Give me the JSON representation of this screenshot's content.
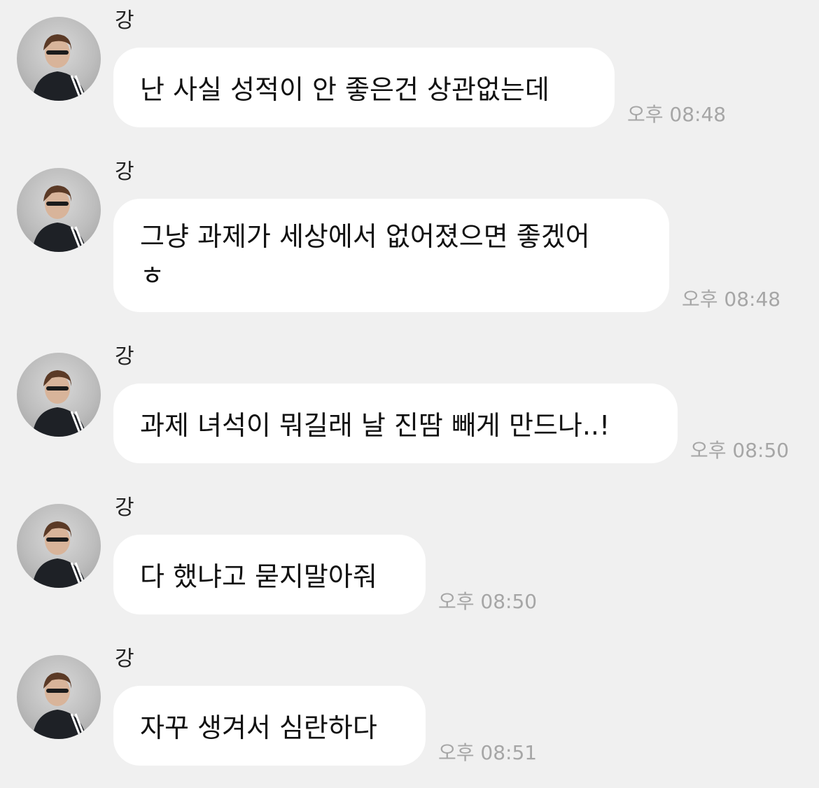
{
  "chat": {
    "messages": [
      {
        "sender": "강",
        "text": "난 사실 성적이 안 좋은건 상관없는데",
        "time": "오후 08:48"
      },
      {
        "sender": "강",
        "text": "그냥 과제가 세상에서 없어졌으면 좋겠어\nㅎ",
        "time": "오후 08:48"
      },
      {
        "sender": "강",
        "text": "과제 녀석이 뭐길래 날 진땀 빼게 만드나..!",
        "time": "오후 08:50"
      },
      {
        "sender": "강",
        "text": "다 했냐고 묻지말아줘",
        "time": "오후 08:50"
      },
      {
        "sender": "강",
        "text": "자꾸 생겨서 심란하다",
        "time": "오후 08:51"
      }
    ]
  },
  "colors": {
    "background": "#f0f0f0",
    "bubble": "#ffffff",
    "timestamp": "#a6a6a6"
  },
  "icons": {
    "avatar": "profile-photo-icon"
  }
}
